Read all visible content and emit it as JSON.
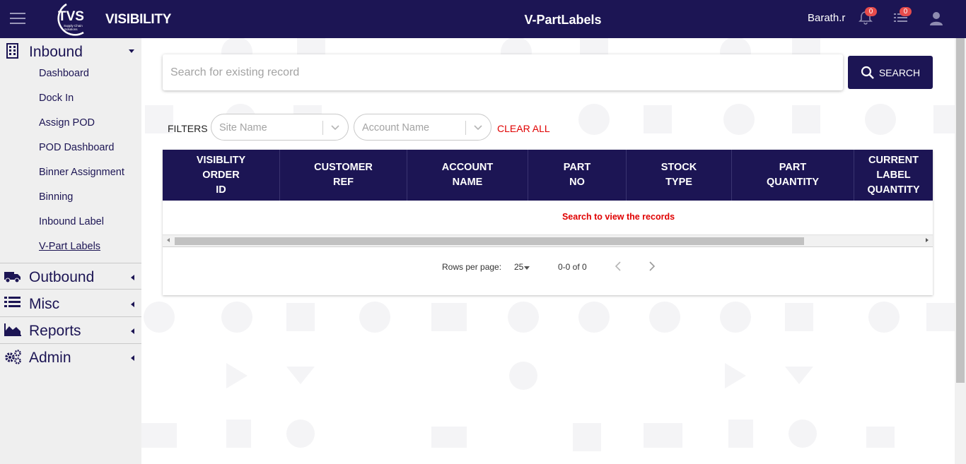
{
  "header": {
    "app_title": "VISIBILITY",
    "page_title": "V-PartLabels",
    "user_name": "Barath.r",
    "notifications_count": "0",
    "tasks_count": "0",
    "logo_text": "TVS",
    "logo_subtext": "Supply Chain Solutions",
    "color": "#1c1554"
  },
  "sidebar": {
    "sections": [
      {
        "label": "Inbound",
        "icon": "building-icon",
        "expanded": true
      },
      {
        "label": "Outbound",
        "icon": "truck-icon",
        "expanded": false
      },
      {
        "label": "Misc",
        "icon": "list-icon",
        "expanded": false
      },
      {
        "label": "Reports",
        "icon": "area-chart-icon",
        "expanded": false
      },
      {
        "label": "Admin",
        "icon": "gears-icon",
        "expanded": false
      }
    ],
    "inbound_items": [
      "Dashboard",
      "Dock In",
      "Assign POD",
      "POD Dashboard",
      "Binner Assignment",
      "Binning",
      "Inbound Label",
      "V-Part Labels"
    ]
  },
  "search": {
    "placeholder": "Search for existing record",
    "button_label": "SEARCH"
  },
  "filters": {
    "label": "FILTERS",
    "site_placeholder": "Site Name",
    "account_placeholder": "Account Name",
    "clear_all": "CLEAR ALL"
  },
  "table": {
    "columns": [
      [
        "VISIBLITY",
        "ORDER",
        "ID"
      ],
      [
        "CUSTOMER",
        "REF"
      ],
      [
        "ACCOUNT",
        "NAME"
      ],
      [
        "PART",
        "NO"
      ],
      [
        "STOCK",
        "TYPE"
      ],
      [
        "PART",
        "QUANTITY"
      ],
      [
        "CURRENT",
        "LABEL",
        "QUANTITY"
      ]
    ],
    "empty_message": "Search to view the records"
  },
  "pagination": {
    "rows_per_page_label": "Rows per page:",
    "rows_per_page": "25",
    "range": "0-0 of 0"
  }
}
